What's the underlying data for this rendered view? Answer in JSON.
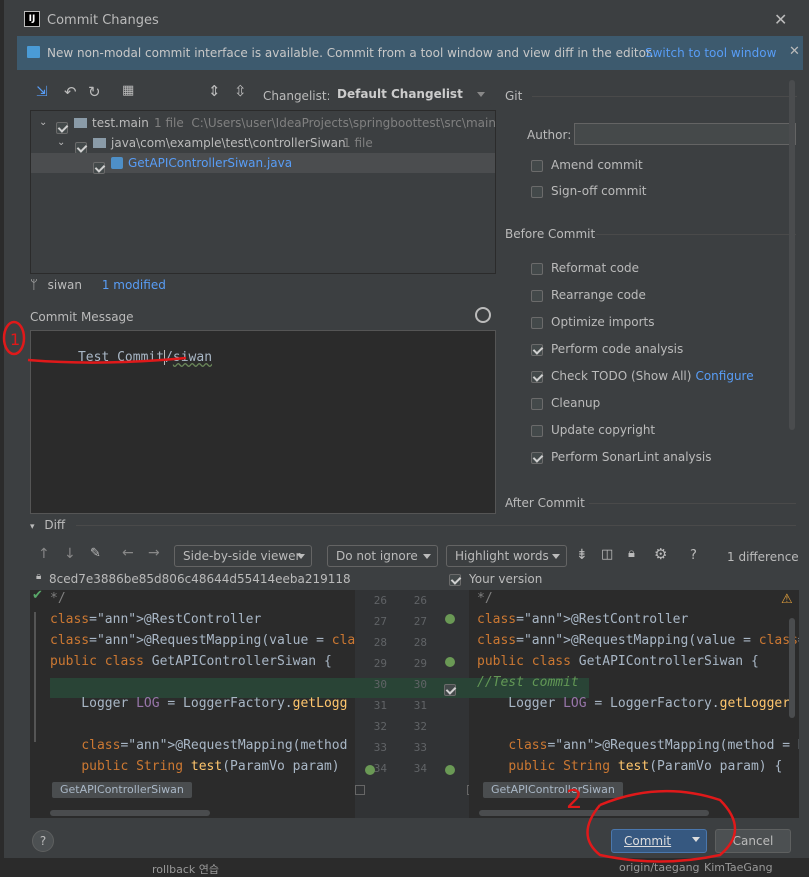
{
  "title": "Commit Changes",
  "banner": {
    "text": "New non-modal commit interface is available. Commit from a tool window and view diff in the editor.",
    "link": "Switch to tool window"
  },
  "toolbar": {
    "changelist_label": "Changelist:",
    "changelist_value": "Default Changelist"
  },
  "tree": [
    {
      "name": "test.main",
      "meta": "1 file  C:\\Users\\user\\IdeaProjects\\springboottest\\src\\main"
    },
    {
      "name": "java\\com\\example\\test\\controllerSiwan",
      "meta": "1 file"
    },
    {
      "name": "GetAPIControllerSiwan.java",
      "meta": ""
    }
  ],
  "branch": {
    "name": "siwan",
    "status": "1 modified"
  },
  "commit_message": {
    "label": "Commit Message",
    "text_a": "Test Commit",
    "text_b": "siwan"
  },
  "git": {
    "section": "Git",
    "author_label": "Author:",
    "author_value": "",
    "amend": "Amend commit",
    "signoff": "Sign-off commit"
  },
  "before_commit": {
    "section": "Before Commit",
    "options": [
      {
        "label": "Reformat code",
        "checked": false
      },
      {
        "label": "Rearrange code",
        "checked": false
      },
      {
        "label": "Optimize imports",
        "checked": false
      },
      {
        "label": "Perform code analysis",
        "checked": true
      },
      {
        "label": "Check TODO (Show All)",
        "checked": true,
        "link": "Configure"
      },
      {
        "label": "Cleanup",
        "checked": false
      },
      {
        "label": "Update copyright",
        "checked": false
      },
      {
        "label": "Perform SonarLint analysis",
        "checked": true
      }
    ]
  },
  "after_commit": {
    "section": "After Commit"
  },
  "diff": {
    "header": "Diff",
    "viewer": "Side-by-side viewer",
    "ignore": "Do not ignore",
    "highlight": "Highlight words",
    "help": "?",
    "count": "1 difference",
    "left_rev": "8ced7e3886be85d806c48644d55414eeba219118",
    "right_rev": "Your version",
    "left_tag": "GetAPIControllerSiwan",
    "right_tag": "GetAPIControllerSiwan",
    "gutter_left": [
      "26",
      "27",
      "28",
      "29",
      "30",
      "31",
      "32",
      "33",
      "34"
    ],
    "gutter_right": [
      "26",
      "27",
      "28",
      "29",
      "30",
      "31",
      "32",
      "33",
      "34"
    ],
    "left_lines": [
      "*/",
      "@RestController",
      "@RequestMapping(value = \"/Siwan\")",
      "public class GetAPIControllerSiwan {",
      "",
      "    Logger LOG = LoggerFactory.getLogg",
      "",
      "    @RequestMapping(method = RequestMe",
      "    public String test(ParamVo param)"
    ],
    "right_lines": [
      "*/",
      "@RestController",
      "@RequestMapping(value = \"/Siwan\")",
      "public class GetAPIControllerSiwan {",
      "//Test commit",
      "    Logger LOG = LoggerFactory.getLogger",
      "",
      "    @RequestMapping(method = RequestMeth",
      "    public String test(ParamVo param) {"
    ]
  },
  "footer": {
    "help": "?",
    "commit": "Commit",
    "cancel": "Cancel"
  },
  "background": {
    "rollback": "rollback 연습",
    "origin": "origin/taegang",
    "user": "KimTaeGang"
  },
  "annotations": {
    "one": "1",
    "two": "2"
  },
  "colors": {
    "accent": "#365880",
    "primary_button": "#365880",
    "link": "#589df6",
    "annotation": "#e0191a"
  }
}
